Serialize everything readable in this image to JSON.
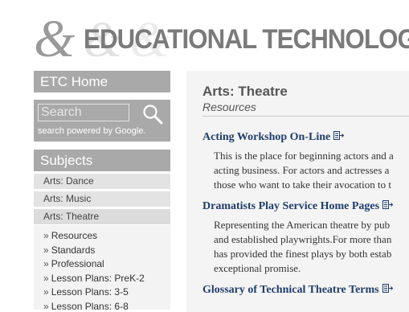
{
  "header": {
    "logo_text": "EDUCATIONAL TECHNOLOGY"
  },
  "sidebar": {
    "home_label": "ETC Home",
    "search": {
      "placeholder": "Search",
      "note": "search powered by Google."
    },
    "subjects_title": "Subjects",
    "subjects": [
      {
        "label": "Arts: Dance"
      },
      {
        "label": "Arts: Music"
      },
      {
        "label": "Arts: Theatre"
      }
    ],
    "subnav": [
      {
        "label": "Resources"
      },
      {
        "label": "Standards"
      },
      {
        "label": "Professional"
      },
      {
        "label": "Lesson Plans: PreK-2"
      },
      {
        "label": "Lesson Plans: 3-5"
      },
      {
        "label": "Lesson Plans: 6-8"
      }
    ]
  },
  "main": {
    "title": "Arts: Theatre",
    "subtitle": "Resources",
    "entries": [
      {
        "title": "Acting Workshop On-Line",
        "lines": [
          "This is the place for beginning actors and a",
          "acting business. For actors and actresses a",
          "those who want to take their avocation to t"
        ]
      },
      {
        "title": "Dramatists Play Service Home Pages",
        "lines": [
          "Representing the American theatre by pub",
          "and established playwrights.For more than",
          "has provided the finest plays by both estab",
          "exceptional promise."
        ]
      },
      {
        "title": "Glossary of Technical Theatre Terms",
        "lines": []
      }
    ]
  }
}
